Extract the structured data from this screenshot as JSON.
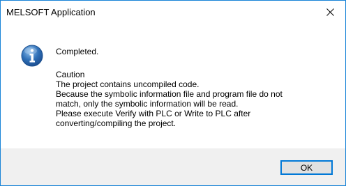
{
  "window": {
    "title": "MELSOFT Application",
    "close_icon": "close-icon"
  },
  "message": {
    "icon": "information-icon",
    "headline": "Completed.",
    "lines": [
      "Caution",
      "The project contains uncompiled code.",
      "Because the symbolic information file and program file do not",
      "match, only the symbolic information will be read.",
      "Please execute Verify with PLC or Write to PLC after",
      "converting/compiling the project."
    ]
  },
  "buttons": {
    "ok_label": "OK"
  },
  "colors": {
    "border": "#1883d7",
    "footer_bg": "#f0f0f0",
    "button_bg": "#e1e1e1",
    "button_focus": "#0078d7",
    "icon_blue": "#2f6fb6"
  }
}
